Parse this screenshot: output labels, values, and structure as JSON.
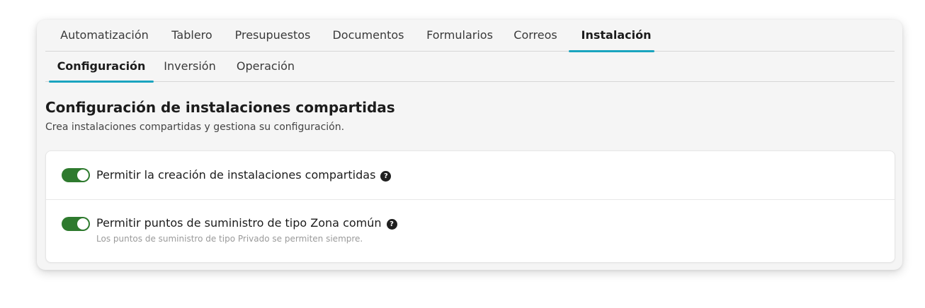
{
  "tabs": [
    {
      "label": "Automatización",
      "active": false
    },
    {
      "label": "Tablero",
      "active": false
    },
    {
      "label": "Presupuestos",
      "active": false
    },
    {
      "label": "Documentos",
      "active": false
    },
    {
      "label": "Formularios",
      "active": false
    },
    {
      "label": "Correos",
      "active": false
    },
    {
      "label": "Instalación",
      "active": true
    }
  ],
  "subtabs": [
    {
      "label": "Configuración",
      "active": true
    },
    {
      "label": "Inversión",
      "active": false
    },
    {
      "label": "Operación",
      "active": false
    }
  ],
  "section": {
    "title": "Configuración de instalaciones compartidas",
    "description": "Crea instalaciones compartidas y gestiona su configuración."
  },
  "settings": [
    {
      "label": "Permitir la creación de instalaciones compartidas",
      "enabled": true,
      "help_icon": "question-mark"
    },
    {
      "label": "Permitir puntos de suministro de tipo Zona común",
      "enabled": true,
      "help_icon": "question-mark",
      "note": "Los puntos de suministro de tipo Privado se permiten siempre."
    }
  ],
  "colors": {
    "accent": "#1aa4bf",
    "toggle_on": "#2e7a2e"
  }
}
